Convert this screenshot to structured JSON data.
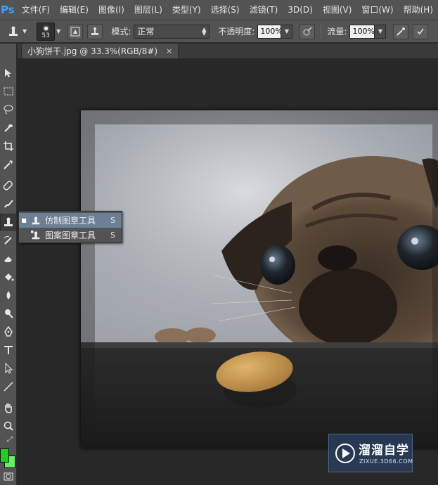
{
  "app": {
    "logo": "Ps"
  },
  "menubar": {
    "items": [
      {
        "label": "文件(F)"
      },
      {
        "label": "编辑(E)"
      },
      {
        "label": "图像(I)"
      },
      {
        "label": "图层(L)"
      },
      {
        "label": "类型(Y)"
      },
      {
        "label": "选择(S)"
      },
      {
        "label": "滤镜(T)"
      },
      {
        "label": "3D(D)"
      },
      {
        "label": "视图(V)"
      },
      {
        "label": "窗口(W)"
      },
      {
        "label": "帮助(H)"
      }
    ]
  },
  "options": {
    "brush_size": "53",
    "mode_label": "模式:",
    "mode_value": "正常",
    "opacity_label": "不透明度:",
    "opacity_value": "100%",
    "flow_label": "流量:",
    "flow_value": "100%"
  },
  "document": {
    "tab_title": "小狗饼干.jpg @ 33.3%(RGB/8#)",
    "tab_close": "×"
  },
  "flyout": {
    "items": [
      {
        "label": "仿制图章工具",
        "shortcut": "S",
        "selected": true
      },
      {
        "label": "图案图章工具",
        "shortcut": "S",
        "selected": false
      }
    ]
  },
  "watermark": {
    "title": "溜溜自学",
    "subtitle": "ZIXUE.3D66.COM"
  },
  "colors": {
    "foreground": "#22cc22",
    "background": "#66ee66",
    "ui_panel": "#535353",
    "selection_highlight": "#6c7f96"
  }
}
